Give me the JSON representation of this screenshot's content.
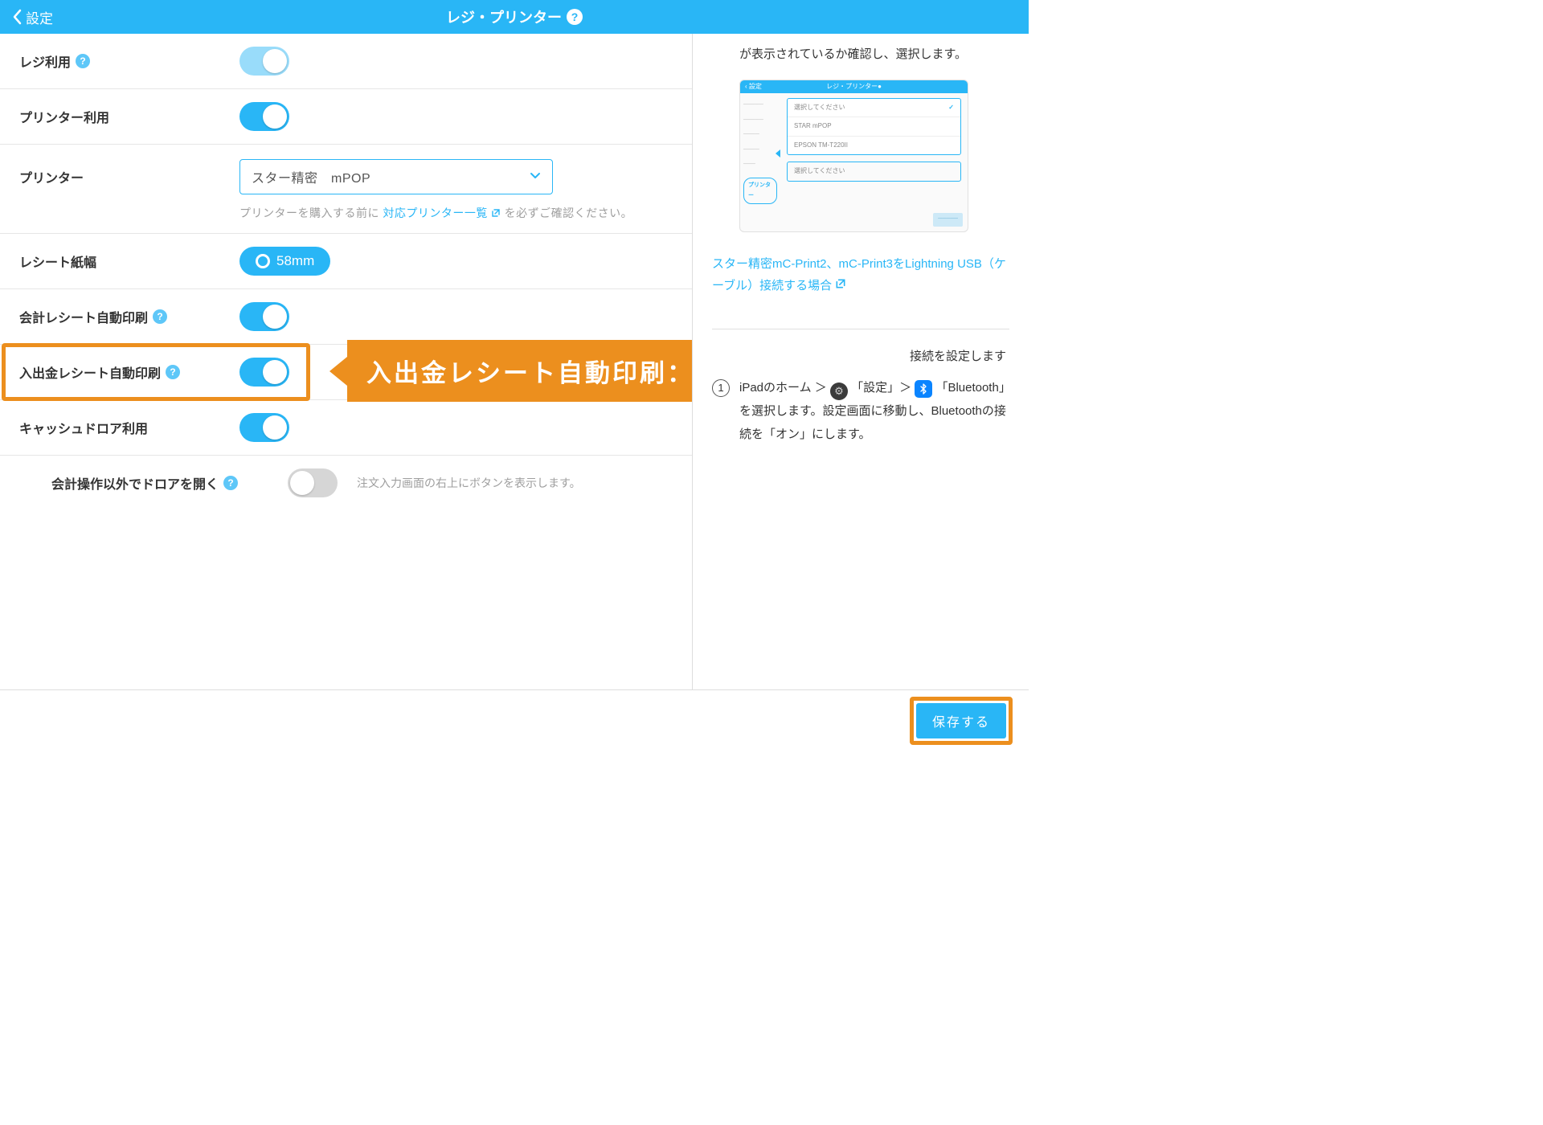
{
  "header": {
    "back_label": "設定",
    "title": "レジ・プリンター"
  },
  "rows": {
    "register_use": {
      "label": "レジ利用",
      "on": true,
      "light": true
    },
    "printer_use": {
      "label": "プリンター利用",
      "on": true
    },
    "printer": {
      "label": "プリンター",
      "selected": "スター精密　mPOP",
      "note_before": "プリンターを購入する前に ",
      "note_link": "対応プリンター一覧",
      "note_after": " を必ずご確認ください。"
    },
    "receipt_width": {
      "label": "レシート紙幅",
      "value": "58mm"
    },
    "auto_print_account": {
      "label": "会計レシート自動印刷",
      "on": true
    },
    "auto_print_cash": {
      "label": "入出金レシート自動印刷",
      "on": true
    },
    "cash_drawer": {
      "label": "キャッシュドロア利用",
      "on": true
    },
    "open_drawer": {
      "label": "会計操作以外でドロアを開く",
      "on": false,
      "desc": "注文入力画面の右上にボタンを表示します。"
    }
  },
  "callout": "入出金レシート自動印刷：オン",
  "right": {
    "top_text": "が表示されているか確認し、選択します。",
    "thumb": {
      "title": "レジ・プリンター",
      "back": "設定",
      "opt_placeholder": "選択してください",
      "opt1": "STAR mPOP",
      "opt2": "EPSON TM-T220II",
      "bubble": "プリンター"
    },
    "link_text": "スター精密mC-Print2、mC-Print3をLightning USB（ケーブル）接続する場合",
    "mid_text": "接続を設定します",
    "step1_a": "iPadのホーム ＞ ",
    "step1_b": "「設定」＞ ",
    "step1_c": "「Bluetooth」を選択します。設定画面に移動し、Bluetoothの接続を「オン」にします。"
  },
  "footer": {
    "save": "保存する"
  }
}
